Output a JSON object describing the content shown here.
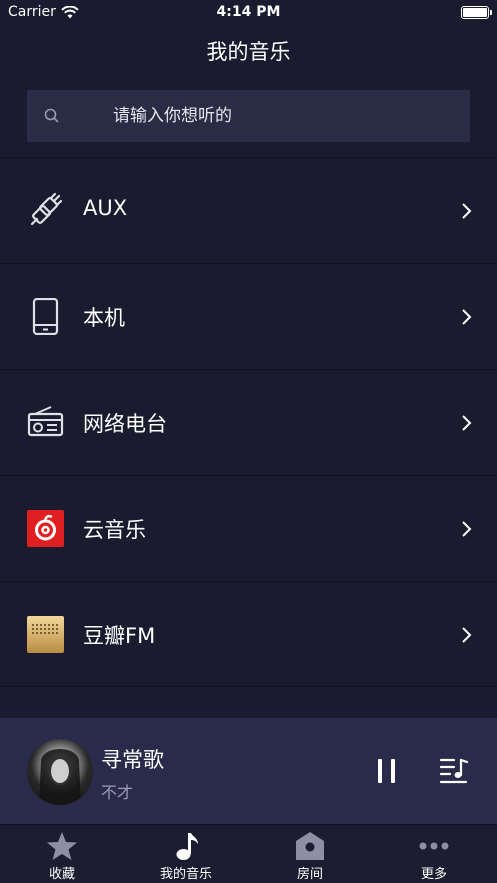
{
  "status_bar": {
    "carrier": "Carrier",
    "time": "4:14 PM"
  },
  "header": {
    "title": "我的音乐"
  },
  "search": {
    "placeholder": "请输入你想听的"
  },
  "sources": [
    {
      "label": "AUX",
      "icon": "plug-icon"
    },
    {
      "label": "本机",
      "icon": "phone-icon"
    },
    {
      "label": "网络电台",
      "icon": "radio-icon"
    },
    {
      "label": "云音乐",
      "icon": "netease-cloud-music-icon",
      "color": "#e02020"
    },
    {
      "label": "豆瓣FM",
      "icon": "douban-fm-icon",
      "color": "#c9a55c"
    }
  ],
  "now_playing": {
    "title": "寻常歌",
    "artist": "不才"
  },
  "tabs": [
    {
      "label": "收藏",
      "icon": "star-icon"
    },
    {
      "label": "我的音乐",
      "icon": "music-note-icon"
    },
    {
      "label": "房间",
      "icon": "house-icon"
    },
    {
      "label": "更多",
      "icon": "more-dots-icon"
    }
  ],
  "colors": {
    "background": "#1a1b2e",
    "search_bg": "#2a2c45",
    "player_bg": "#2a2b4a",
    "accent_red": "#e02020"
  }
}
